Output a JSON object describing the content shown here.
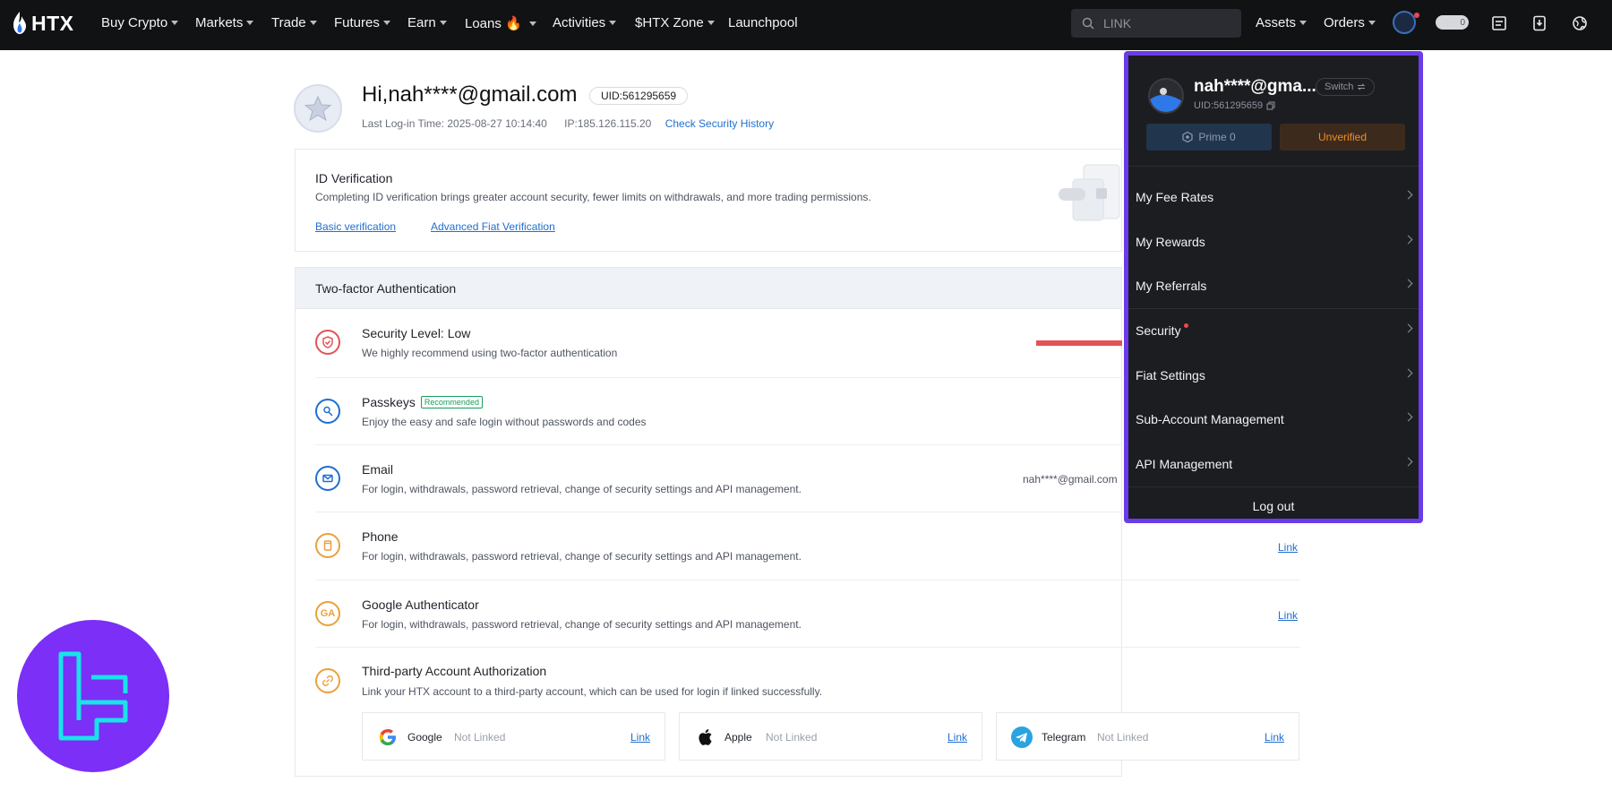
{
  "nav": {
    "logo_text": "HTX",
    "items": [
      {
        "label": "Buy Crypto",
        "caret": true
      },
      {
        "label": "Markets",
        "caret": true
      },
      {
        "label": "Trade",
        "caret": true
      },
      {
        "label": "Futures",
        "caret": true
      },
      {
        "label": "Earn",
        "caret": true
      },
      {
        "label": "Loans 🔥",
        "caret": true
      },
      {
        "label": "Activities",
        "caret": true
      },
      {
        "label": "$HTX Zone",
        "caret": true
      },
      {
        "label": "Launchpool",
        "caret": false
      }
    ],
    "search_placeholder": "LINK",
    "assets_label": "Assets",
    "orders_label": "Orders",
    "toggle_value": "0"
  },
  "profile": {
    "greeting": "Hi,nah****@gmail.com",
    "uid": "UID:561295659",
    "last_login": "Last Log-in Time: 2025-08-27 10:14:40",
    "ip": "IP:185.126.115.20",
    "security_history_link": "Check Security History"
  },
  "id_verification": {
    "title": "ID Verification",
    "description": "Completing ID verification brings greater account security, fewer limits on withdrawals, and more trading permissions.",
    "basic_link": "Basic verification",
    "advanced_link": "Advanced Fiat Verification"
  },
  "two_factor": {
    "header": "Two-factor Authentication",
    "rows": [
      {
        "title": "Security Level: Low",
        "desc": "We highly recommend using two-factor authentication"
      },
      {
        "title": "Passkeys",
        "badge": "Recommended",
        "desc": "Enjoy the easy and safe login without passwords and codes"
      },
      {
        "title": "Email",
        "desc": "For login, withdrawals, password retrieval, change of security settings and API management.",
        "value": "nah****@gmail.com"
      },
      {
        "title": "Phone",
        "desc": "For login, withdrawals, password retrieval, change of security settings and API management.",
        "link": "Link"
      },
      {
        "title": "Google Authenticator",
        "desc": "For login, withdrawals, password retrieval, change of security settings and API management.",
        "link": "Link"
      },
      {
        "title": "Third-party Account Authorization",
        "desc": "Link your HTX account to a third-party account, which can be used for login if linked successfully."
      }
    ],
    "third_party": [
      {
        "name": "Google",
        "status": "Not Linked",
        "link": "Link"
      },
      {
        "name": "Apple",
        "status": "Not Linked",
        "link": "Link"
      },
      {
        "name": "Telegram",
        "status": "Not Linked",
        "link": "Link"
      }
    ]
  },
  "dropdown": {
    "name": "nah****@gma...",
    "uid": "UID:561295659",
    "switch_label": "Switch",
    "prime_label": "Prime 0",
    "unverified_label": "Unverified",
    "items": [
      "My Fee Rates",
      "My Rewards",
      "My Referrals",
      "Security",
      "Fiat Settings",
      "Sub-Account Management",
      "API Management"
    ],
    "logout_label": "Log out"
  },
  "colors": {
    "nav_bg": "#111214",
    "link": "#1f6fd1",
    "dropdown_border": "#6a3ce8",
    "danger": "#e35355",
    "unverified": "#f28c28"
  }
}
